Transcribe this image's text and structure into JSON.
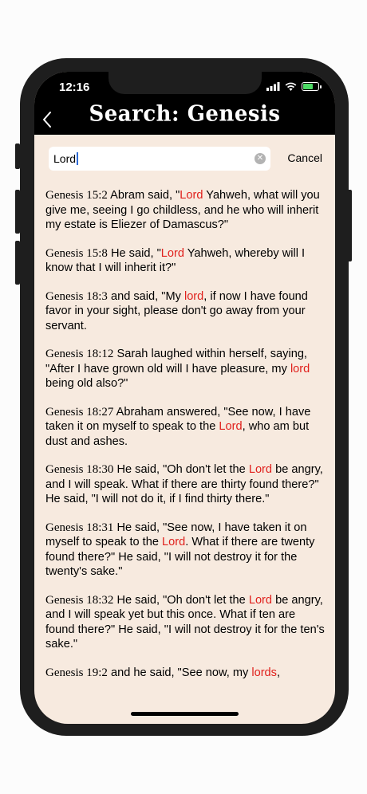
{
  "status_bar": {
    "time": "12:16"
  },
  "header": {
    "title": "Search: Genesis",
    "back_icon": "chevron-left-icon"
  },
  "search": {
    "value": "Lord",
    "cancel_label": "Cancel",
    "clear_icon": "clear-icon"
  },
  "colors": {
    "highlight": "#e0201c",
    "background": "#f7eadf",
    "header": "#000000",
    "battery": "#4cd964"
  },
  "results": [
    {
      "ref": "Genesis 15:2",
      "pre": " Abram said, \"",
      "hit": "Lord",
      "post": " Yahweh, what will you give me, seeing I go childless, and he who will inherit my estate is Eliezer of Damascus?\""
    },
    {
      "ref": "Genesis 15:8",
      "pre": " He said, \"",
      "hit": "Lord",
      "post": " Yahweh, whereby will I know that I will inherit it?\""
    },
    {
      "ref": "Genesis 18:3",
      "pre": " and said, \"My ",
      "hit": "lord",
      "post": ", if now I have found favor in your sight, please don't go away from your servant."
    },
    {
      "ref": "Genesis 18:12",
      "pre": " Sarah laughed within herself, saying, \"After I have grown old will I have pleasure, my ",
      "hit": "lord",
      "post": " being old also?\""
    },
    {
      "ref": "Genesis 18:27",
      "pre": " Abraham answered, \"See now, I have taken it on myself to speak to the ",
      "hit": "Lord",
      "post": ", who am but dust and ashes."
    },
    {
      "ref": "Genesis 18:30",
      "pre": " He said, \"Oh don't let the ",
      "hit": "Lord",
      "post": " be angry, and I will speak. What if there are thirty found there?\" He said, \"I will not do it, if I find thirty there.\""
    },
    {
      "ref": "Genesis 18:31",
      "pre": " He said, \"See now, I have taken it on myself to speak to the ",
      "hit": "Lord",
      "post": ". What if there are twenty found there?\" He said, \"I will not destroy it for the twenty's sake.\""
    },
    {
      "ref": "Genesis 18:32",
      "pre": " He said, \"Oh don't let the ",
      "hit": "Lord",
      "post": " be angry, and I will speak yet but this once. What if ten are found there?\" He said, \"I will not destroy it for the ten's sake.\""
    },
    {
      "ref": "Genesis 19:2",
      "pre": " and he said, \"See now, my ",
      "hit": "lords",
      "post": ","
    }
  ]
}
